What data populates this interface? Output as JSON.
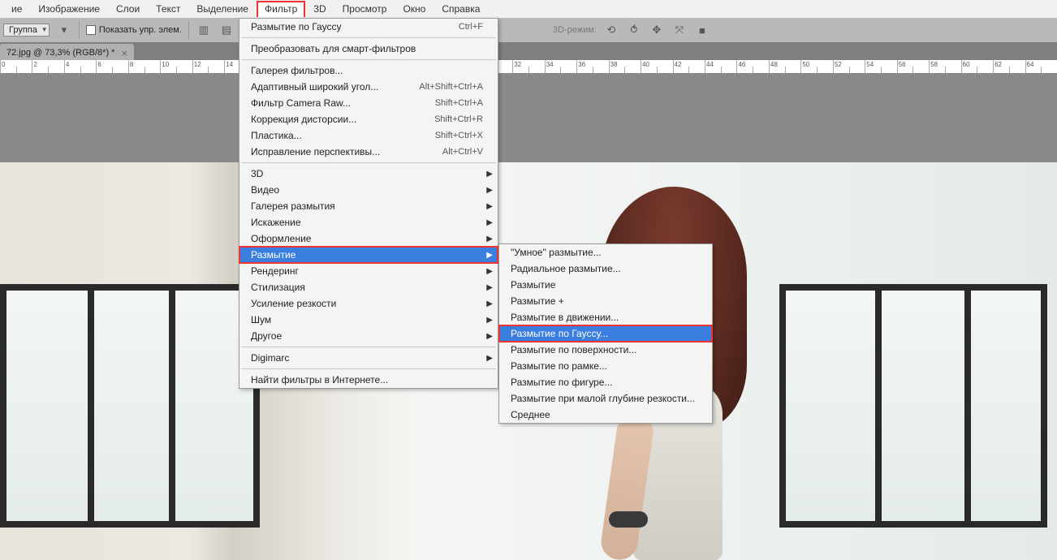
{
  "menubar": {
    "items": [
      "ие",
      "Изображение",
      "Слои",
      "Текст",
      "Выделение",
      "Фильтр",
      "3D",
      "Просмотр",
      "Окно",
      "Справка"
    ],
    "active_index": 5
  },
  "options_bar": {
    "dropdown_label": "Группа",
    "checkbox_label": "Показать упр. элем.",
    "mode_3d_label": "3D-режим:"
  },
  "document_tab": {
    "title": "72.jpg @ 73,3% (RGB/8*) *"
  },
  "filter_menu": [
    {
      "label": "Размытие по Гауссу",
      "shortcut": "Ctrl+F"
    },
    {
      "sep": true
    },
    {
      "label": "Преобразовать для смарт-фильтров"
    },
    {
      "sep": true
    },
    {
      "label": "Галерея фильтров..."
    },
    {
      "label": "Адаптивный широкий угол...",
      "shortcut": "Alt+Shift+Ctrl+A"
    },
    {
      "label": "Фильтр Camera Raw...",
      "shortcut": "Shift+Ctrl+A"
    },
    {
      "label": "Коррекция дисторсии...",
      "shortcut": "Shift+Ctrl+R"
    },
    {
      "label": "Пластика...",
      "shortcut": "Shift+Ctrl+X"
    },
    {
      "label": "Исправление перспективы...",
      "shortcut": "Alt+Ctrl+V"
    },
    {
      "sep": true
    },
    {
      "label": "3D",
      "submenu": true
    },
    {
      "label": "Видео",
      "submenu": true
    },
    {
      "label": "Галерея размытия",
      "submenu": true
    },
    {
      "label": "Искажение",
      "submenu": true
    },
    {
      "label": "Оформление",
      "submenu": true
    },
    {
      "label": "Размытие",
      "submenu": true,
      "highlight": true,
      "outlined": true
    },
    {
      "label": "Рендеринг",
      "submenu": true
    },
    {
      "label": "Стилизация",
      "submenu": true
    },
    {
      "label": "Усиление резкости",
      "submenu": true
    },
    {
      "label": "Шум",
      "submenu": true
    },
    {
      "label": "Другое",
      "submenu": true
    },
    {
      "sep": true
    },
    {
      "label": "Digimarc",
      "submenu": true
    },
    {
      "sep": true
    },
    {
      "label": "Найти фильтры в Интернете..."
    }
  ],
  "blur_submenu": [
    {
      "label": "\"Умное\" размытие..."
    },
    {
      "label": "Радиальное размытие..."
    },
    {
      "label": "Размытие"
    },
    {
      "label": "Размытие +"
    },
    {
      "label": "Размытие в движении..."
    },
    {
      "label": "Размытие по Гауссу...",
      "highlight": true,
      "outlined": true
    },
    {
      "label": "Размытие по поверхности..."
    },
    {
      "label": "Размытие по рамке..."
    },
    {
      "label": "Размытие по фигуре..."
    },
    {
      "label": "Размытие при малой глубине резкости..."
    },
    {
      "label": "Среднее"
    }
  ],
  "ruler": {
    "start": 0,
    "end": 66,
    "step": 2
  }
}
